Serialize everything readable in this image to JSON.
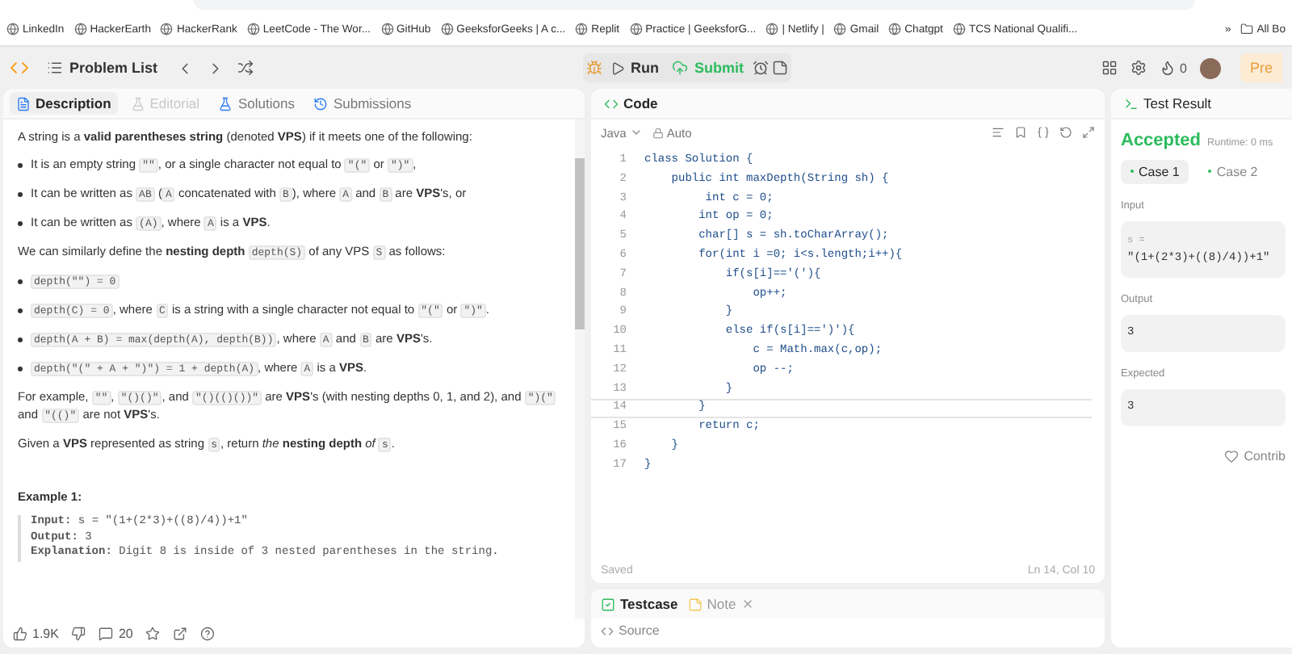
{
  "bookmarks": [
    {
      "label": "LinkedIn"
    },
    {
      "label": "HackerEarth"
    },
    {
      "label": "HackerRank"
    },
    {
      "label": "LeetCode - The Wor..."
    },
    {
      "label": "GitHub"
    },
    {
      "label": "GeeksforGeeks | A c..."
    },
    {
      "label": "Replit"
    },
    {
      "label": "Practice | GeeksforG..."
    },
    {
      "label": "| Netlify |"
    },
    {
      "label": "Gmail"
    },
    {
      "label": "Chatgpt"
    },
    {
      "label": "TCS National Qualifi..."
    }
  ],
  "bookmarks_more": "»",
  "bookmarks_folder": "All Bo",
  "nav": {
    "problem_list": "Problem List",
    "run": "Run",
    "submit": "Submit",
    "streak": "0",
    "premium": "Pre"
  },
  "description": {
    "tabs": [
      {
        "label": "Description",
        "selected": true,
        "disabled": false
      },
      {
        "label": "Editorial",
        "selected": false,
        "disabled": true
      },
      {
        "label": "Solutions",
        "selected": false,
        "disabled": false
      },
      {
        "label": "Submissions",
        "selected": false,
        "disabled": false
      }
    ],
    "blocks": [
      {
        "kind": "paragraph",
        "parts": [
          {
            "kind": "text",
            "text": "A string is a **valid parentheses string** (denoted **VPS**) if it meets one of the following:"
          }
        ]
      },
      {
        "kind": "bullet",
        "parts": [
          {
            "kind": "text",
            "text": "It is an empty string "
          },
          {
            "kind": "code",
            "text": "\"\""
          },
          {
            "kind": "text",
            "text": ", or a single character not equal to "
          },
          {
            "kind": "code",
            "text": "\"(\""
          },
          {
            "kind": "text",
            "text": " or "
          },
          {
            "kind": "code",
            "text": "\")\""
          },
          {
            "kind": "text",
            "text": ","
          }
        ]
      },
      {
        "kind": "bullet",
        "parts": [
          {
            "kind": "text",
            "text": "It can be written as "
          },
          {
            "kind": "code",
            "text": "AB"
          },
          {
            "kind": "text",
            "text": " ("
          },
          {
            "kind": "code",
            "text": "A"
          },
          {
            "kind": "text",
            "text": " concatenated with "
          },
          {
            "kind": "code",
            "text": "B"
          },
          {
            "kind": "text",
            "text": "), where "
          },
          {
            "kind": "code",
            "text": "A"
          },
          {
            "kind": "text",
            "text": " and "
          },
          {
            "kind": "code",
            "text": "B"
          },
          {
            "kind": "text",
            "text": " are **VPS**'s, or"
          }
        ]
      },
      {
        "kind": "bullet",
        "parts": [
          {
            "kind": "text",
            "text": "It can be written as "
          },
          {
            "kind": "code",
            "text": "(A)"
          },
          {
            "kind": "text",
            "text": ", where "
          },
          {
            "kind": "code",
            "text": "A"
          },
          {
            "kind": "text",
            "text": " is a **VPS**."
          }
        ]
      },
      {
        "kind": "paragraph",
        "parts": [
          {
            "kind": "text",
            "text": "We can similarly define the **nesting depth** "
          },
          {
            "kind": "code",
            "text": "depth(S)"
          },
          {
            "kind": "text",
            "text": " of any VPS "
          },
          {
            "kind": "code",
            "text": "S"
          },
          {
            "kind": "text",
            "text": " as follows:"
          }
        ]
      },
      {
        "kind": "bullet",
        "parts": [
          {
            "kind": "code",
            "text": "depth(\"\") = 0"
          }
        ]
      },
      {
        "kind": "bullet",
        "parts": [
          {
            "kind": "code",
            "text": "depth(C) = 0"
          },
          {
            "kind": "text",
            "text": ", where "
          },
          {
            "kind": "code",
            "text": "C"
          },
          {
            "kind": "text",
            "text": " is a string with a single character not equal to "
          },
          {
            "kind": "code",
            "text": "\"(\""
          },
          {
            "kind": "text",
            "text": " or "
          },
          {
            "kind": "code",
            "text": "\")\""
          },
          {
            "kind": "text",
            "text": "."
          }
        ]
      },
      {
        "kind": "bullet",
        "parts": [
          {
            "kind": "code",
            "text": "depth(A + B) = max(depth(A), depth(B))"
          },
          {
            "kind": "text",
            "text": ", where "
          },
          {
            "kind": "code",
            "text": "A"
          },
          {
            "kind": "text",
            "text": " and "
          },
          {
            "kind": "code",
            "text": "B"
          },
          {
            "kind": "text",
            "text": " are **VPS**'s."
          }
        ]
      },
      {
        "kind": "bullet",
        "parts": [
          {
            "kind": "code",
            "text": "depth(\"(\" + A + \")\") = 1 + depth(A)"
          },
          {
            "kind": "text",
            "text": ", where "
          },
          {
            "kind": "code",
            "text": "A"
          },
          {
            "kind": "text",
            "text": " is a **VPS**."
          }
        ]
      },
      {
        "kind": "paragraph",
        "parts": [
          {
            "kind": "text",
            "text": "For example, "
          },
          {
            "kind": "code",
            "text": "\"\""
          },
          {
            "kind": "text",
            "text": ", "
          },
          {
            "kind": "code",
            "text": "\"()()\""
          },
          {
            "kind": "text",
            "text": ", and "
          },
          {
            "kind": "code",
            "text": "\"()(()())\""
          },
          {
            "kind": "text",
            "text": " are **VPS**'s (with nesting depths 0, 1, and 2), and "
          },
          {
            "kind": "code",
            "text": "\")(\""
          },
          {
            "kind": "text",
            "text": " and "
          },
          {
            "kind": "code",
            "text": "\"(()\""
          },
          {
            "kind": "text",
            "text": " are not **VPS**'s."
          }
        ]
      },
      {
        "kind": "paragraph",
        "parts": [
          {
            "kind": "text",
            "text": "Given a **VPS** represented as string "
          },
          {
            "kind": "code",
            "text": "s"
          },
          {
            "kind": "text",
            "text": ", return *the* **nesting depth** *of* "
          },
          {
            "kind": "code",
            "text": "s"
          },
          {
            "kind": "text",
            "text": "."
          }
        ]
      }
    ],
    "example_title": "Example 1:",
    "example_lines": [
      "**Input:** s = \"(1+(2*3)+((8)/4))+1\"",
      "**Output:** 3",
      "**Explanation:** Digit 8 is inside of 3 nested parentheses in the string."
    ],
    "likes": "1.9K",
    "comments": "20"
  },
  "code": {
    "title": "Code",
    "language": "Java",
    "mode": "Auto",
    "lines": [
      {
        "number": "1",
        "text": "class Solution {",
        "current": false
      },
      {
        "number": "2",
        "text": "    public int maxDepth(String sh) {",
        "current": false
      },
      {
        "number": "3",
        "text": "         int c = 0;",
        "current": false
      },
      {
        "number": "4",
        "text": "        int op = 0;",
        "current": false
      },
      {
        "number": "5",
        "text": "        char[] s = sh.toCharArray();",
        "current": false
      },
      {
        "number": "6",
        "text": "        for(int i =0; i<s.length;i++){",
        "current": false
      },
      {
        "number": "7",
        "text": "            if(s[i]=='('){",
        "current": false
      },
      {
        "number": "8",
        "text": "                op++;",
        "current": false
      },
      {
        "number": "9",
        "text": "            }",
        "current": false
      },
      {
        "number": "10",
        "text": "            else if(s[i]==')'){",
        "current": false
      },
      {
        "number": "11",
        "text": "                c = Math.max(c,op);",
        "current": false
      },
      {
        "number": "12",
        "text": "                op --;",
        "current": false
      },
      {
        "number": "13",
        "text": "            }",
        "current": false
      },
      {
        "number": "14",
        "text": "        }",
        "current": true
      },
      {
        "number": "15",
        "text": "        return c;",
        "current": false
      },
      {
        "number": "16",
        "text": "    }",
        "current": false
      },
      {
        "number": "17",
        "text": "}",
        "current": false
      }
    ],
    "status": "Saved",
    "position": "Ln 14, Col 10"
  },
  "bottom_tabs": [
    {
      "label": "Testcase",
      "selected": true,
      "closable": false
    },
    {
      "label": "Note",
      "selected": false,
      "closable": true
    }
  ],
  "source": "Source",
  "result": {
    "title": "Test Result",
    "verdict": "Accepted",
    "runtime": "Runtime: 0 ms",
    "cases": [
      {
        "label": "Case 1",
        "selected": true
      },
      {
        "label": "Case 2",
        "selected": false
      }
    ],
    "input_label": "Input",
    "input_name": "s =",
    "input_value": "\"(1+(2*3)+((8)/4))+1\"",
    "output_label": "Output",
    "output_value": "3",
    "expected_label": "Expected",
    "expected_value": "3",
    "contribute": "Contrib"
  }
}
